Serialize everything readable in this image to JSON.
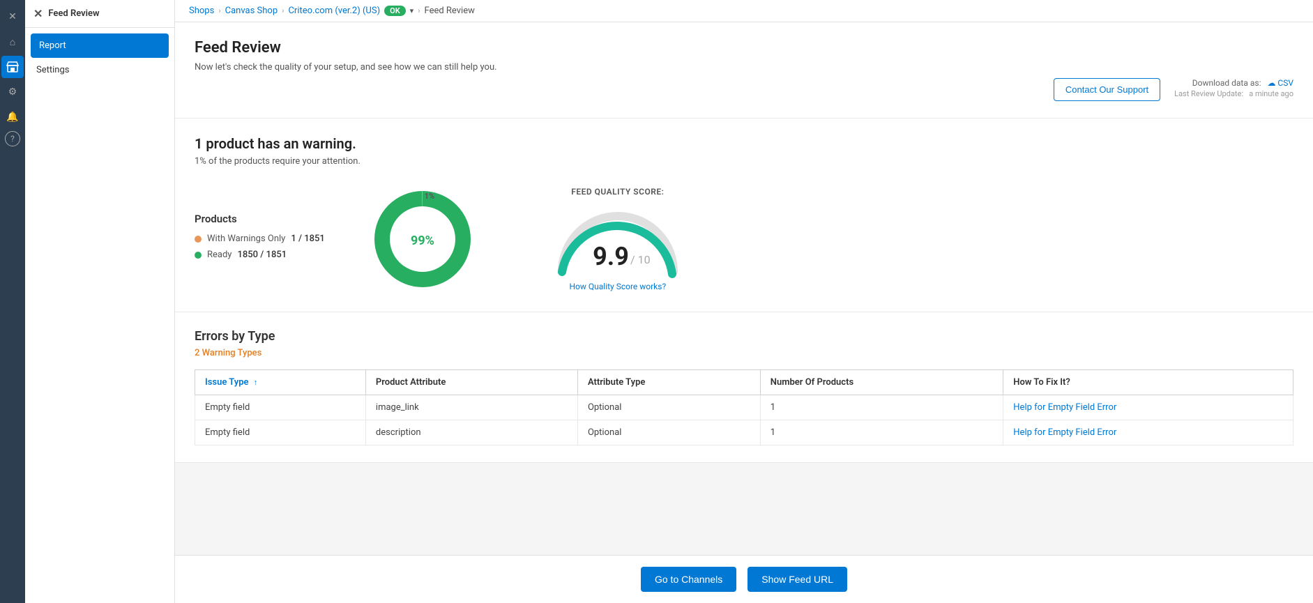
{
  "sidebar": {
    "icons": [
      {
        "name": "close-icon",
        "glyph": "✕"
      },
      {
        "name": "home-icon",
        "glyph": "⌂"
      },
      {
        "name": "store-icon",
        "glyph": "🏪"
      },
      {
        "name": "gear-icon",
        "glyph": "⚙"
      },
      {
        "name": "bell-icon",
        "glyph": "🔔"
      },
      {
        "name": "help-icon",
        "glyph": "?"
      }
    ]
  },
  "left_panel": {
    "title": "Feed Review",
    "menu": [
      {
        "label": "Report",
        "active": true
      },
      {
        "label": "Settings",
        "active": false
      }
    ]
  },
  "breadcrumb": {
    "shops": "Shops",
    "canvas_shop": "Canvas Shop",
    "channel": "Criteo.com (ver.2) (US)",
    "ok_label": "OK",
    "current": "Feed Review"
  },
  "page": {
    "title": "Feed Review",
    "subtitle": "Now let's check the quality of your setup, and see how we can still help you.",
    "contact_support_label": "Contact Our Support",
    "download_label": "Download data as:",
    "csv_label": "CSV",
    "last_review_label": "Last Review Update:",
    "last_review_value": "a minute ago"
  },
  "stats": {
    "headline": "1 product has an warning.",
    "subtext": "1% of the products require your attention.",
    "products_title": "Products",
    "legend": [
      {
        "label": "With Warnings Only",
        "value": "1 / 1851",
        "color": "#e8965a"
      },
      {
        "label": "Ready",
        "value": "1850 / 1851",
        "color": "#27ae60"
      }
    ],
    "donut": {
      "warning_pct": 1,
      "ready_pct": 99,
      "warning_color": "#e8965a",
      "ready_color": "#27ae60",
      "center_label": "99%",
      "top_label": "1%"
    },
    "gauge": {
      "title": "FEED QUALITY SCORE:",
      "score": "9.9",
      "max": "/ 10",
      "link_label": "How Quality Score works?",
      "value": 9.9,
      "color_start": "#1abc9c",
      "color_end": "#27ae60"
    }
  },
  "errors": {
    "title": "Errors by Type",
    "warning_types": "2 Warning Types",
    "table": {
      "headers": [
        "Issue Type",
        "Product Attribute",
        "Attribute Type",
        "Number Of Products",
        "How To Fix It?"
      ],
      "rows": [
        {
          "issue_type": "Empty field",
          "product_attribute": "image_link",
          "attribute_type": "Optional",
          "number_of_products": "1",
          "how_to_fix": "Help for Empty Field Error"
        },
        {
          "issue_type": "Empty field",
          "product_attribute": "description",
          "attribute_type": "Optional",
          "number_of_products": "1",
          "how_to_fix": "Help for Empty Field Error"
        }
      ]
    }
  },
  "footer": {
    "go_to_channels_label": "Go to Channels",
    "show_feed_url_label": "Show Feed URL"
  }
}
